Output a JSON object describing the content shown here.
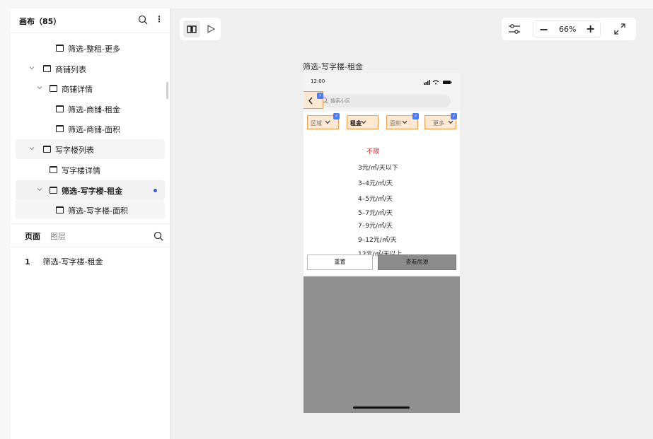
{
  "sidebar": {
    "title": "画布（85）",
    "tree": [
      {
        "label": "筛选-整租-更多"
      },
      {
        "label": "商铺列表"
      },
      {
        "label": "商铺详情"
      },
      {
        "label": "筛选-商铺-租金"
      },
      {
        "label": "筛选-商铺-面积"
      },
      {
        "label": "写字楼列表"
      },
      {
        "label": "写字楼详情"
      },
      {
        "label": "筛选-写字楼-租金"
      },
      {
        "label": "筛选-写字楼-面积"
      }
    ],
    "tabs": {
      "pages": "页面",
      "layers": "图层"
    },
    "pages": [
      {
        "num": "1",
        "label": "筛选-写字楼-租金"
      }
    ]
  },
  "toolbar": {
    "zoom": "66%",
    "zoom_minus": "−",
    "zoom_plus": "+",
    "more": "⋮"
  },
  "canvas": {
    "frame_label": "筛选-写字楼-租金",
    "phone": {
      "time": "12:00",
      "search_placeholder": "搜索小区",
      "filters": [
        "区域",
        "租金",
        "面积",
        "更多"
      ],
      "active_filter": "租金",
      "options": [
        "不限",
        "3元/㎡/天以下",
        "3–4元/㎡/天",
        "4–5元/㎡/天",
        "5–7元/㎡/天",
        "7–9元/㎡/天",
        "9–12元/㎡/天",
        "12元/㎡/天以上"
      ],
      "reset_label": "重置",
      "view_label": "查看房源"
    }
  },
  "colors": {
    "accent": "#2a58ea",
    "highlight_fill": "#fde8d2",
    "highlight_border": "#f0a050",
    "selected_option": "#e02020",
    "overlay": "#8f8f8f"
  }
}
